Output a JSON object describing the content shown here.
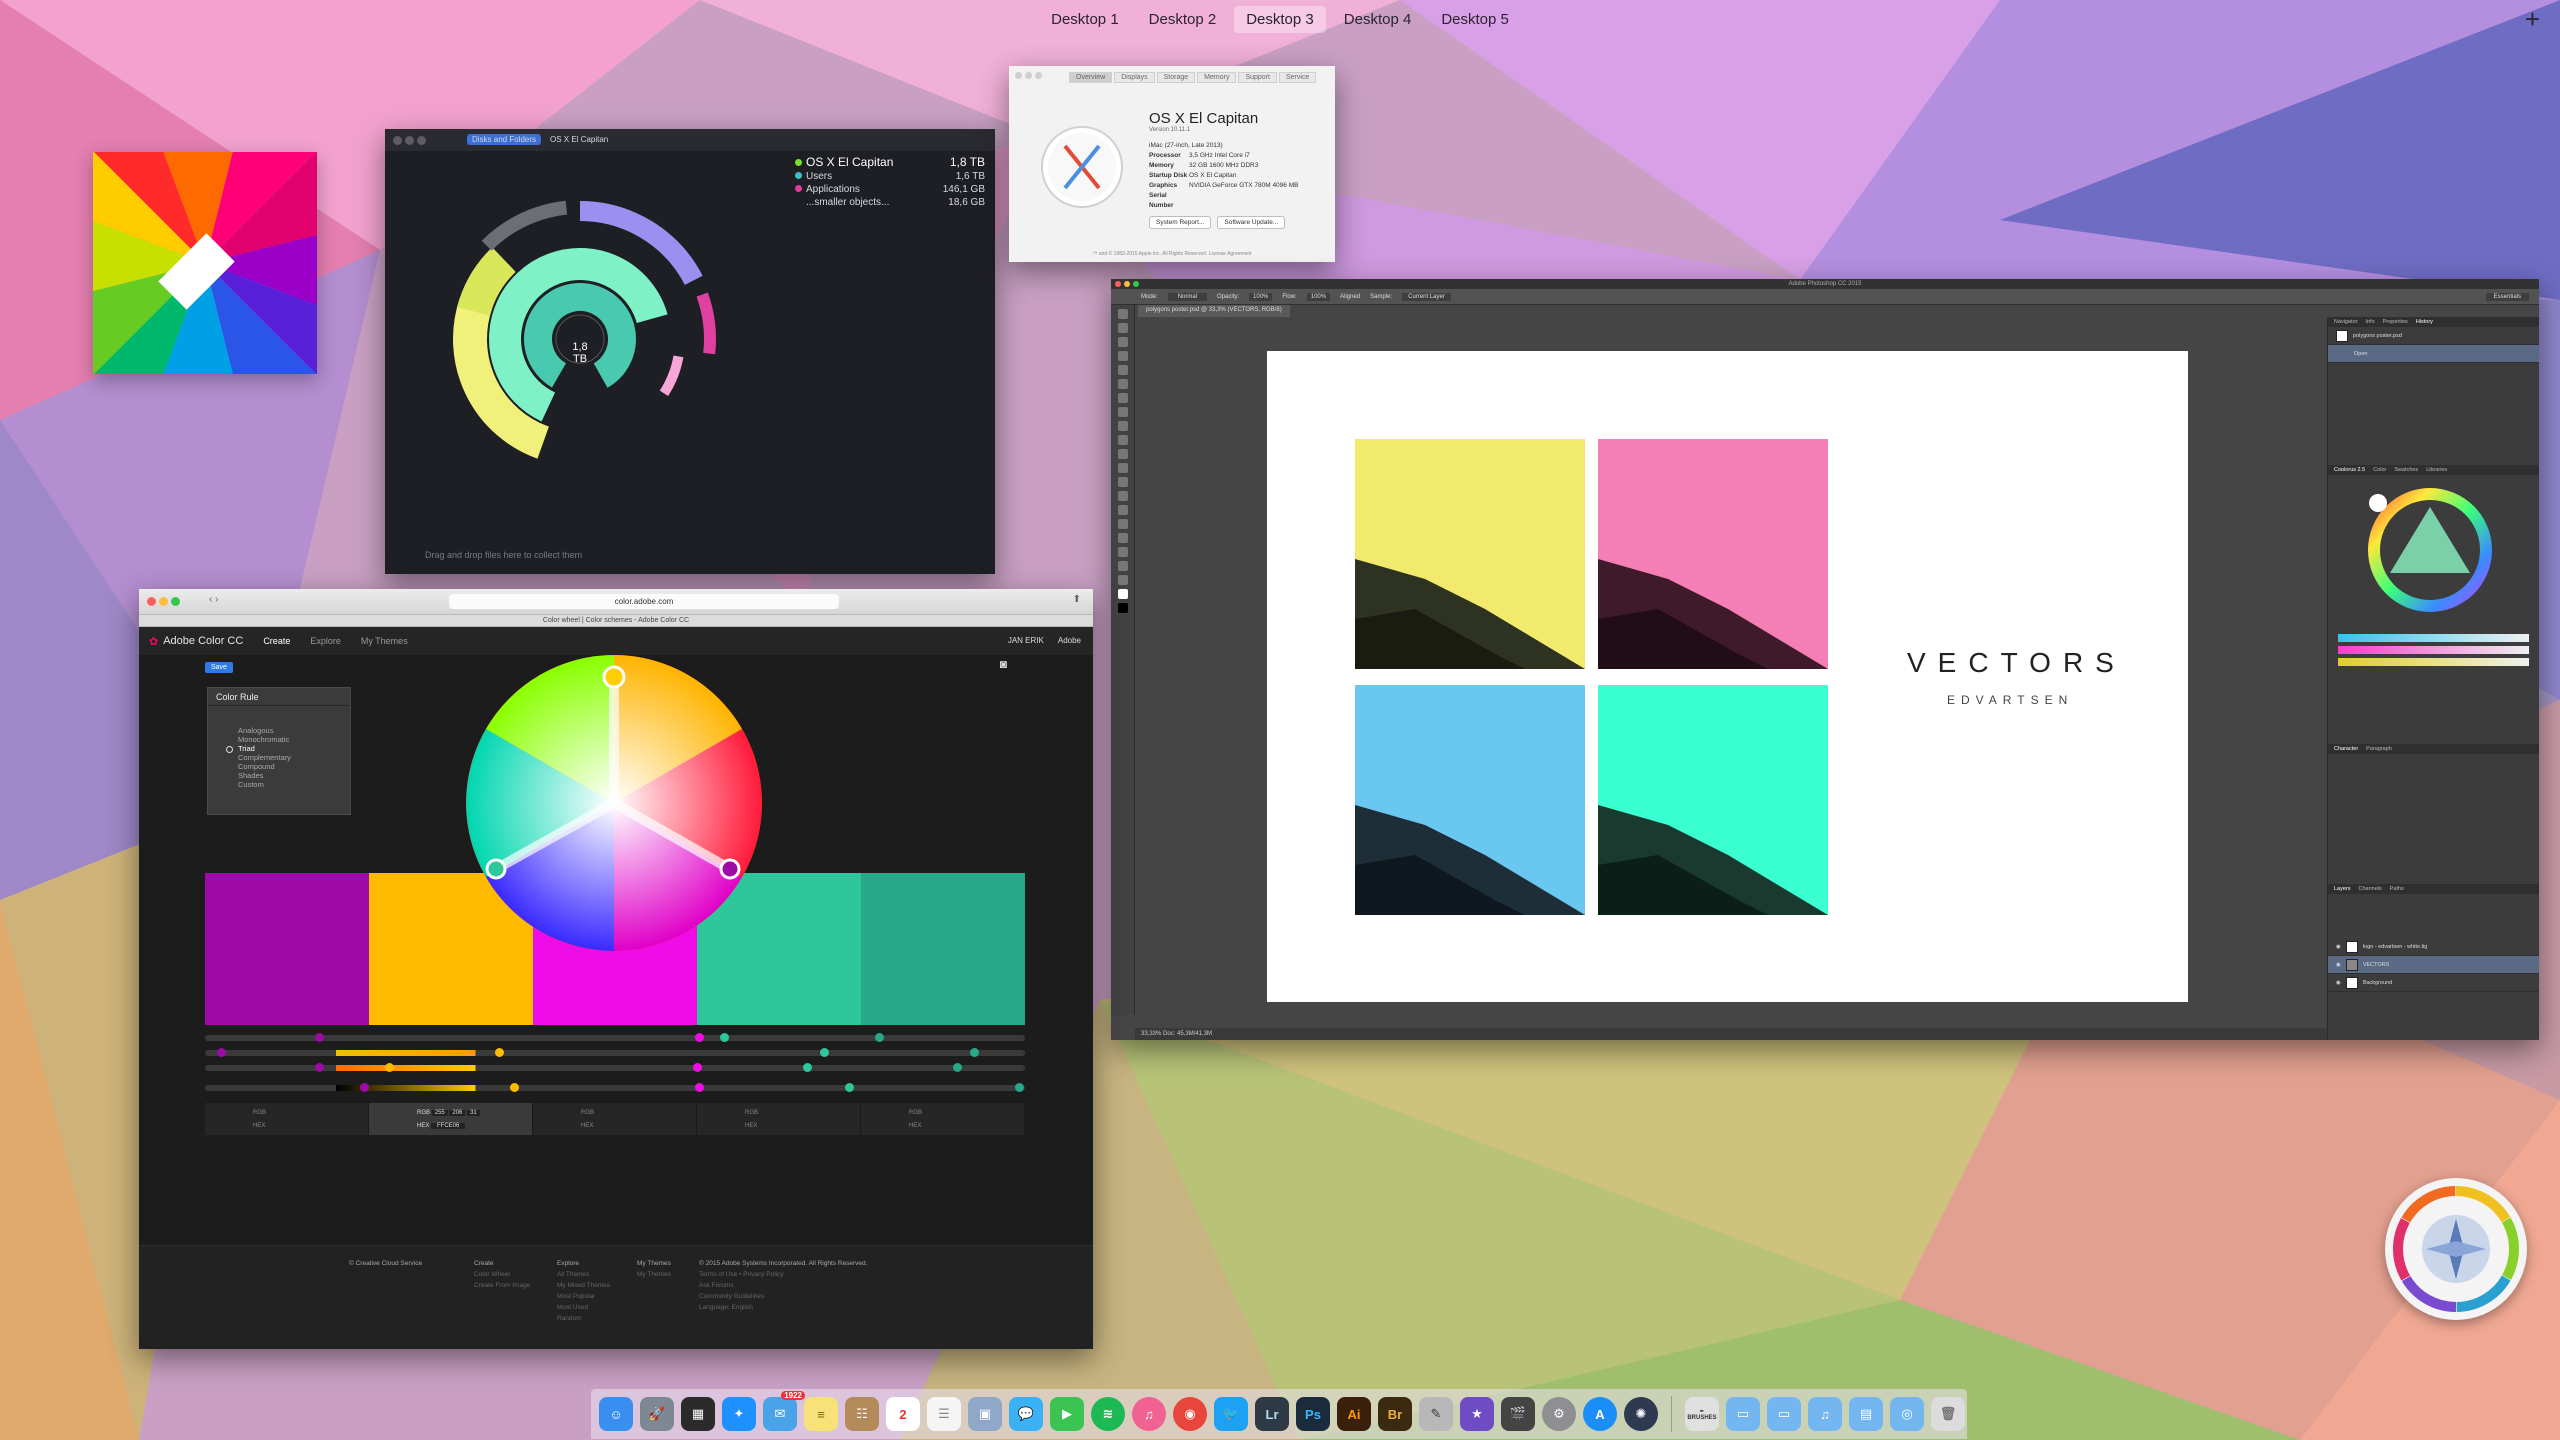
{
  "spaces": {
    "tabs": [
      "Desktop 1",
      "Desktop 2",
      "Desktop 3",
      "Desktop 4",
      "Desktop 5"
    ],
    "active": "Desktop 3",
    "add_label": "+"
  },
  "daisydisk": {
    "crumb_root": "Disks and Folders",
    "crumb_current": "OS X El Capitan",
    "center_top": "1,8",
    "center_bottom": "TB",
    "legend": [
      {
        "name": "OS X El Capitan",
        "size": "1,8 TB",
        "color": "#7cdd2a"
      },
      {
        "name": "Users",
        "size": "1,6 TB",
        "color": "#3cc0c8"
      },
      {
        "name": "Applications",
        "size": "146,1 GB",
        "color": "#e03b9b"
      },
      {
        "name": "...smaller objects...",
        "size": "18,6 GB",
        "color": "#cccccc"
      }
    ],
    "hint": "Drag and drop files here to collect them"
  },
  "about_mac": {
    "tabs": [
      "Overview",
      "Displays",
      "Storage",
      "Memory",
      "Support",
      "Service"
    ],
    "os_name": "OS X El Capitan",
    "version": "Version 10.11.1",
    "specs": [
      {
        "k": "iMac (27-inch, Late 2013)",
        "v": ""
      },
      {
        "k": "Processor",
        "v": "3,5 GHz Intel Core i7"
      },
      {
        "k": "Memory",
        "v": "32 GB 1600 MHz DDR3"
      },
      {
        "k": "Startup Disk",
        "v": "OS X El Capitan"
      },
      {
        "k": "Graphics",
        "v": "NVIDIA GeForce GTX 780M 4096 MB"
      },
      {
        "k": "Serial Number",
        "v": ""
      }
    ],
    "buttons": [
      "System Report...",
      "Software Update..."
    ],
    "copyright": "™ and © 1983-2015 Apple Inc. All Rights Reserved. License Agreement"
  },
  "photoshop": {
    "title": "Adobe Photoshop CC 2015",
    "doc_tab": "polygons poster.psd @ 33,3% (VECTORS, RGB/8)",
    "options": [
      "Mode:",
      "Normal",
      "Opacity:",
      "100%",
      "Flow:",
      "100%",
      "Aligned",
      "Sample:",
      "Current Layer"
    ],
    "workspace": "Essentials",
    "poster_title": "VECTORS",
    "poster_subtitle": "EDVARTSEN",
    "status": "33,33%     Doc: 45,3M/41,3M",
    "panel_tabs_top": [
      "Navigator",
      "Info",
      "Properties",
      "History"
    ],
    "history_items": [
      "polygons poster.psd",
      "Open"
    ],
    "panel_tabs_color": [
      "Coolorus 2.5",
      "Color",
      "Swatches",
      "Libraries"
    ],
    "panel_tabs_char": [
      "Character",
      "Paragraph"
    ],
    "panel_tabs_layers": [
      "Layers",
      "Channels",
      "Paths"
    ],
    "layers": [
      {
        "name": "logo - edvartsen - white.tig",
        "selected": false
      },
      {
        "name": "VECTORS",
        "selected": true
      },
      {
        "name": "Background",
        "selected": false
      }
    ]
  },
  "safari": {
    "url": "color.adobe.com",
    "page_title": "Color wheel | Color schemes - Adobe Color CC",
    "app_name": "Adobe Color CC",
    "nav": [
      "Create",
      "Explore",
      "My Themes"
    ],
    "user": "JAN ERIK",
    "adobe": "Adobe",
    "save": "Save",
    "rule_title": "Color Rule",
    "rules": [
      "Analogous",
      "Monochromatic",
      "Triad",
      "Complementary",
      "Compound",
      "Shades",
      "Custom"
    ],
    "selected_rule": "Triad",
    "swatches": [
      "#9e0aa6",
      "#ffbb00",
      "#f00ce6",
      "#2ec79c",
      "#26a889"
    ],
    "rgb_label": "RGB",
    "hex_label": "HEX",
    "selected_rgb": [
      "255",
      "206",
      "31"
    ],
    "selected_hex": "FFCE06",
    "footer_cols": [
      {
        "head": "© Creative Cloud Service",
        "items": []
      },
      {
        "head": "Create",
        "items": [
          "Color Wheel",
          "Create From Image"
        ]
      },
      {
        "head": "Explore",
        "items": [
          "All Themes",
          "My Mixed Themes",
          "Most Popular",
          "Most Used",
          "Random"
        ]
      },
      {
        "head": "My Themes",
        "items": [
          "My Themes"
        ]
      },
      {
        "head": "© 2015 Adobe Systems Incorporated. All Rights Reserved.",
        "items": [
          "Terms of Use  •  Privacy Policy",
          "Ask Forums",
          "Community Guidelines",
          "Language: English"
        ]
      }
    ]
  },
  "dock": {
    "apps": [
      {
        "name": "finder",
        "label": "",
        "color": "#3a8ef0"
      },
      {
        "name": "launchpad",
        "label": "",
        "color": "#7d8893"
      },
      {
        "name": "mission-control",
        "label": "",
        "color": "#2b2b2b"
      },
      {
        "name": "safari",
        "label": "",
        "color": "#1e90ff"
      },
      {
        "name": "mail",
        "label": "",
        "color": "#4aa3e8"
      },
      {
        "name": "notes",
        "label": "",
        "color": "#f7e27a"
      },
      {
        "name": "contacts",
        "label": "",
        "color": "#b38a5a"
      },
      {
        "name": "calendar",
        "label": "2",
        "color": "#ffffff"
      },
      {
        "name": "reminders",
        "label": "",
        "color": "#f5f5f5"
      },
      {
        "name": "preview",
        "label": "",
        "color": "#8fa8c8"
      },
      {
        "name": "messages",
        "label": "",
        "color": "#3ab0f5"
      },
      {
        "name": "facetime",
        "label": "",
        "color": "#3bc454"
      },
      {
        "name": "spotify",
        "label": "",
        "color": "#1db954"
      },
      {
        "name": "itunes",
        "label": "",
        "color": "#f06292"
      },
      {
        "name": "chrome",
        "label": "",
        "color": "#e8453c"
      },
      {
        "name": "twitter",
        "label": "",
        "color": "#1da1f2"
      },
      {
        "name": "lightroom",
        "label": "Lr",
        "color": "#2d3a45"
      },
      {
        "name": "photoshop",
        "label": "Ps",
        "color": "#1b2b3e"
      },
      {
        "name": "illustrator",
        "label": "Ai",
        "color": "#3a1f0a"
      },
      {
        "name": "bridge",
        "label": "Br",
        "color": "#3b2a10"
      },
      {
        "name": "script-editor",
        "label": "",
        "color": "#b8b8b8"
      },
      {
        "name": "imovie",
        "label": "",
        "color": "#6d4cc4"
      },
      {
        "name": "final-cut",
        "label": "",
        "color": "#444444"
      },
      {
        "name": "system-preferences",
        "label": "",
        "color": "#8e8e93"
      },
      {
        "name": "app-store",
        "label": "",
        "color": "#1c8ef9"
      },
      {
        "name": "daisydisk",
        "label": "",
        "color": "#2e3a50"
      }
    ],
    "badge": "1922",
    "stacks": [
      {
        "name": "brushes",
        "color": "#e0e0e0"
      },
      {
        "name": "folder",
        "color": "#74b7f0"
      },
      {
        "name": "folder",
        "color": "#74b7f0"
      },
      {
        "name": "folder",
        "color": "#74b7f0"
      },
      {
        "name": "folder",
        "color": "#74b7f0"
      },
      {
        "name": "folder",
        "color": "#74b7f0"
      },
      {
        "name": "trash",
        "color": "#dcdcdc"
      }
    ],
    "brushes_label": "BRUSHES"
  }
}
